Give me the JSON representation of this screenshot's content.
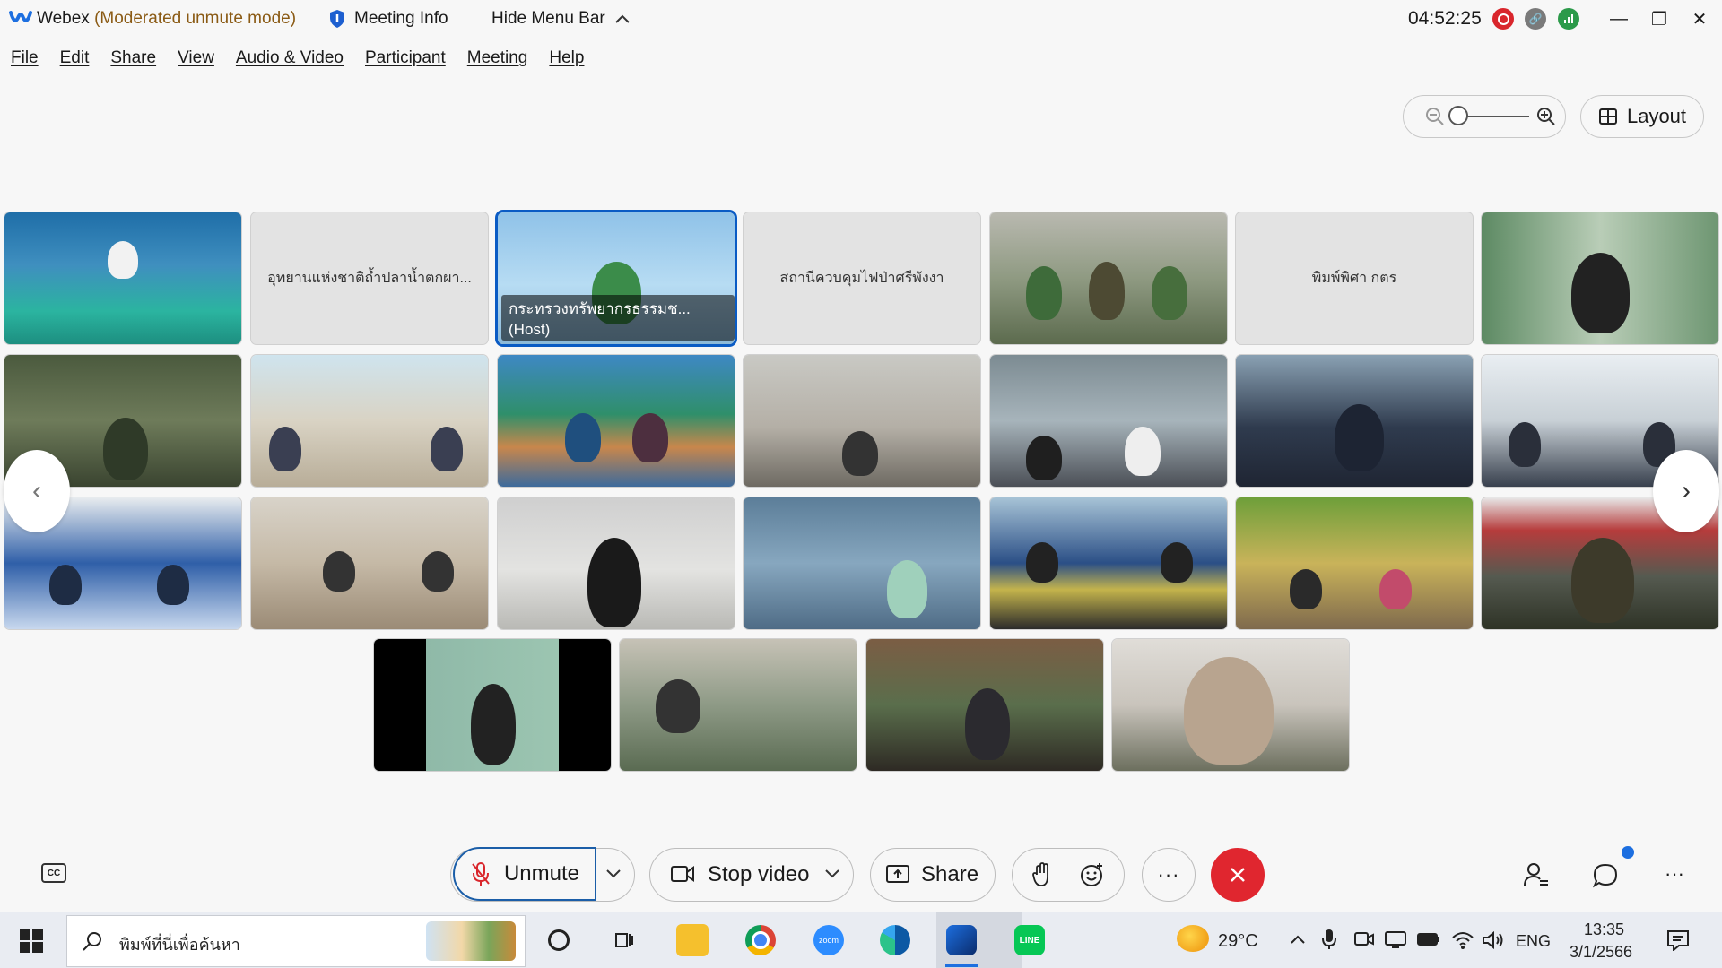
{
  "window": {
    "app_name": "Webex",
    "mode": "(Moderated unmute mode)",
    "meeting_info": "Meeting Info",
    "hide_menu": "Hide Menu Bar",
    "timer": "04:52:25"
  },
  "menu": [
    "File",
    "Edit",
    "Share",
    "View",
    "Audio & Video",
    "Participant",
    "Meeting",
    "Help"
  ],
  "layout_label": "Layout",
  "tiles": {
    "name_1": "อุทยานแห่งชาติถ้ำปลาน้ำตกผา...",
    "name_2": "สถานีควบคุมไฟป่าศรีพังงา",
    "name_3": "พิมพ์พิศา กตร",
    "host_label": "กระทรวงทรัพยากรธรรมช... (Host)"
  },
  "controls": {
    "unmute": "Unmute",
    "stop_video": "Stop video",
    "share": "Share"
  },
  "taskbar": {
    "search_placeholder": "พิมพ์ที่นี่เพื่อค้นหา",
    "temperature": "29°C",
    "language": "ENG",
    "time": "13:35",
    "date": "3/1/2566"
  },
  "colors": {
    "host_border": "#0a5bc4",
    "leave_button": "#e0262f",
    "mode_text": "#8a5a14"
  }
}
